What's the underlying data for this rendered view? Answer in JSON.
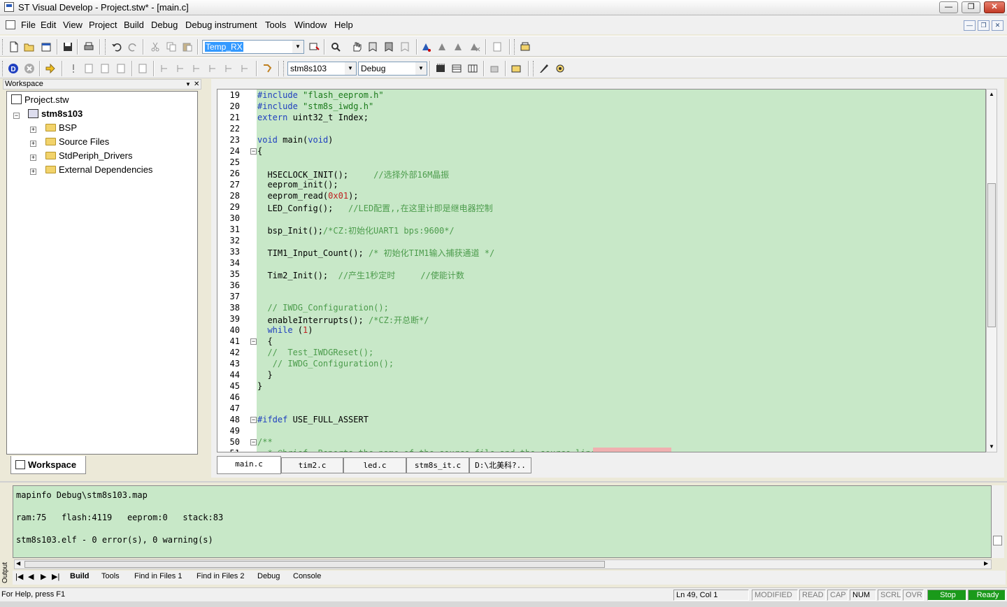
{
  "window": {
    "title": "ST Visual Develop - Project.stw* - [main.c]"
  },
  "menu": [
    "File",
    "Edit",
    "View",
    "Project",
    "Build",
    "Debug",
    "Debug instrument",
    "Tools",
    "Window",
    "Help"
  ],
  "toolbar": {
    "target_combo": "Temp_RX",
    "device_combo": "stm8s103",
    "config_combo": "Debug"
  },
  "workspace": {
    "title": "Workspace",
    "tab": "Workspace",
    "root": "Project.stw",
    "project": "stm8s103",
    "folders": [
      "BSP",
      "Source Files",
      "StdPeriph_Drivers",
      "External Dependencies"
    ]
  },
  "editor": {
    "lines": [
      {
        "n": "19",
        "t": "#include \"flash_eeprom.h\""
      },
      {
        "n": "20",
        "t": "#include \"stm8s_iwdg.h\""
      },
      {
        "n": "21",
        "t": "extern uint32_t Index;"
      },
      {
        "n": "22",
        "t": ""
      },
      {
        "n": "23",
        "t": "void main(void)"
      },
      {
        "n": "24",
        "t": "{"
      },
      {
        "n": "25",
        "t": ""
      },
      {
        "n": "26",
        "t": "  HSECLOCK_INIT();     //选择外部16M晶振"
      },
      {
        "n": "27",
        "t": "  eeprom_init();"
      },
      {
        "n": "28",
        "t": "  eeprom_read(0x01);"
      },
      {
        "n": "29",
        "t": "  LED_Config();   //LED配置,,在这里计即是继电器控制"
      },
      {
        "n": "30",
        "t": ""
      },
      {
        "n": "31",
        "t": "  bsp_Init();/*CZ:初始化UART1 bps:9600*/"
      },
      {
        "n": "32",
        "t": ""
      },
      {
        "n": "33",
        "t": "  TIM1_Input_Count(); /* 初始化TIM1输入捕获通道 */"
      },
      {
        "n": "34",
        "t": ""
      },
      {
        "n": "35",
        "t": "  Tim2_Init();  //产生1秒定时     //使能计数"
      },
      {
        "n": "36",
        "t": ""
      },
      {
        "n": "37",
        "t": ""
      },
      {
        "n": "38",
        "t": "  // IWDG_Configuration();"
      },
      {
        "n": "39",
        "t": "  enableInterrupts(); /*CZ:开总断*/"
      },
      {
        "n": "40",
        "t": "  while (1)"
      },
      {
        "n": "41",
        "t": "  {"
      },
      {
        "n": "42",
        "t": "  //  Test_IWDGReset();"
      },
      {
        "n": "43",
        "t": "   // IWDG_Configuration();"
      },
      {
        "n": "44",
        "t": "  }"
      },
      {
        "n": "45",
        "t": "}"
      },
      {
        "n": "46",
        "t": ""
      },
      {
        "n": "47",
        "t": ""
      },
      {
        "n": "48",
        "t": "#ifdef USE_FULL_ASSERT"
      },
      {
        "n": "49",
        "t": ""
      },
      {
        "n": "50",
        "t": "/**"
      },
      {
        "n": "51",
        "t": "  * @brief  Reports the name of the source file and the source line number"
      }
    ],
    "tabs": [
      "main.c",
      "tim2.c",
      "led.c",
      "stm8s_it.c",
      "D:\\北美科?.."
    ]
  },
  "output": {
    "lines": [
      "mapinfo Debug\\stm8s103.map",
      "",
      "ram:75   flash:4119   eeprom:0   stack:83",
      "",
      "stm8s103.elf - 0 error(s), 0 warning(s)"
    ],
    "label": "Output",
    "tabs": [
      "Build",
      "Tools",
      "Find in Files 1",
      "Find in Files 2",
      "Debug",
      "Console"
    ]
  },
  "status": {
    "help": "For Help, press F1",
    "position": "Ln 49, Col 1",
    "modified": "MODIFIED",
    "read": "READ",
    "cap": "CAP",
    "num": "NUM",
    "scrl": "SCRL",
    "ovr": "OVR",
    "stop": "Stop",
    "ready": "Ready"
  },
  "colors": {
    "editor_bg": "#c8e8c8",
    "keyword": "#1f3fbf",
    "comment": "#4c9c4c",
    "status_green": "#1a9a1a"
  }
}
